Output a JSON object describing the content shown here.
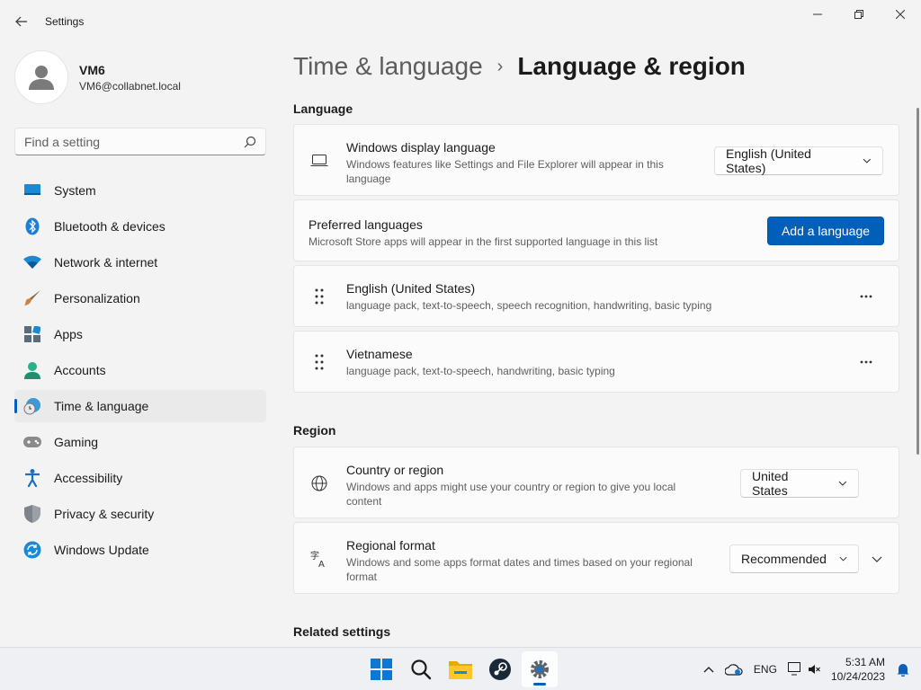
{
  "window": {
    "title": "Settings"
  },
  "profile": {
    "name": "VM6",
    "email": "VM6@collabnet.local"
  },
  "search": {
    "placeholder": "Find a setting"
  },
  "nav": {
    "items": [
      {
        "label": "System",
        "icon": "system-icon"
      },
      {
        "label": "Bluetooth & devices",
        "icon": "bluetooth-icon"
      },
      {
        "label": "Network & internet",
        "icon": "wifi-icon"
      },
      {
        "label": "Personalization",
        "icon": "brush-icon"
      },
      {
        "label": "Apps",
        "icon": "apps-icon"
      },
      {
        "label": "Accounts",
        "icon": "accounts-icon"
      },
      {
        "label": "Time & language",
        "icon": "time-language-icon",
        "active": true
      },
      {
        "label": "Gaming",
        "icon": "gamepad-icon"
      },
      {
        "label": "Accessibility",
        "icon": "accessibility-icon"
      },
      {
        "label": "Privacy & security",
        "icon": "shield-icon"
      },
      {
        "label": "Windows Update",
        "icon": "update-icon"
      }
    ]
  },
  "breadcrumb": {
    "parent": "Time & language",
    "separator": "›",
    "current": "Language & region"
  },
  "language_section": {
    "title": "Language",
    "display_language": {
      "title": "Windows display language",
      "desc": "Windows features like Settings and File Explorer will appear in this language",
      "value": "English (United States)"
    },
    "preferred": {
      "title": "Preferred languages",
      "desc": "Microsoft Store apps will appear in the first supported language in this list",
      "button": "Add a language"
    },
    "languages": [
      {
        "title": "English (United States)",
        "desc": "language pack, text-to-speech, speech recognition, handwriting, basic typing"
      },
      {
        "title": "Vietnamese",
        "desc": "language pack, text-to-speech, handwriting, basic typing"
      }
    ]
  },
  "region_section": {
    "title": "Region",
    "country": {
      "title": "Country or region",
      "desc": "Windows and apps might use your country or region to give you local content",
      "value": "United States"
    },
    "format": {
      "title": "Regional format",
      "desc": "Windows and some apps format dates and times based on your regional format",
      "value": "Recommended"
    }
  },
  "related": {
    "title": "Related settings"
  },
  "taskbar": {
    "language": "ENG",
    "time": "5:31 AM",
    "date": "10/24/2023"
  },
  "colors": {
    "accent": "#005fb8",
    "background": "#f3f3f3",
    "card": "#fbfbfb"
  }
}
